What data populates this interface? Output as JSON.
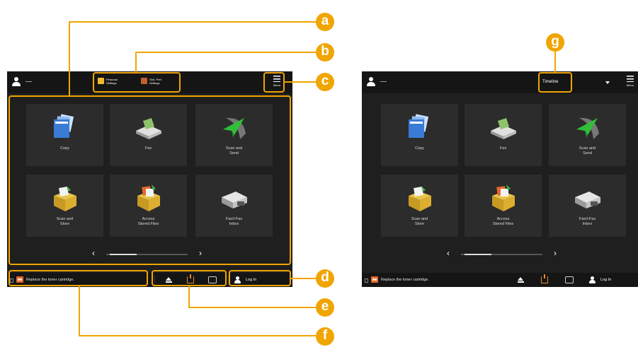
{
  "left_screen": {
    "user_name": "-----",
    "personal_settings_label": "Personal\nSettings",
    "shared_settings_label": "Shd. Pref.\nSettings",
    "menu_label": "Menu",
    "tiles": [
      {
        "label": "Copy",
        "icon": "copy-icon"
      },
      {
        "label": "Fax",
        "icon": "fax-icon"
      },
      {
        "label": "Scan and\nSend",
        "icon": "scan-send-icon"
      },
      {
        "label": "Scan and\nStore",
        "icon": "scan-store-icon"
      },
      {
        "label": "Access\nStored Files",
        "icon": "access-files-icon"
      },
      {
        "label": "Fax/I-Fax\nInbox",
        "icon": "fax-inbox-icon"
      }
    ],
    "pager_prev": "‹",
    "pager_next": "›",
    "status_message": "Replace the toner cartridge.",
    "login_label": "Log In"
  },
  "right_screen": {
    "user_name": "-----",
    "timeline_label": "Timeline",
    "menu_label": "Menu",
    "tiles": [
      {
        "label": "Copy",
        "icon": "copy-icon"
      },
      {
        "label": "Fax",
        "icon": "fax-icon"
      },
      {
        "label": "Scan and\nSend",
        "icon": "scan-send-icon"
      },
      {
        "label": "Scan and\nStore",
        "icon": "scan-store-icon"
      },
      {
        "label": "Access\nStored Files",
        "icon": "access-files-icon"
      },
      {
        "label": "Fax/I-Fax\nInbox",
        "icon": "fax-inbox-icon"
      }
    ],
    "pager_prev": "‹",
    "pager_next": "›",
    "status_message": "Replace the toner cartridge.",
    "login_label": "Log In"
  },
  "callouts": [
    "a",
    "b",
    "c",
    "d",
    "e",
    "f",
    "g"
  ],
  "colors": {
    "highlight": "#f0a500",
    "screen_bg": "#1f1f1f",
    "tile_bg": "#2c2c2c",
    "toner_warning": "#e8672a"
  }
}
